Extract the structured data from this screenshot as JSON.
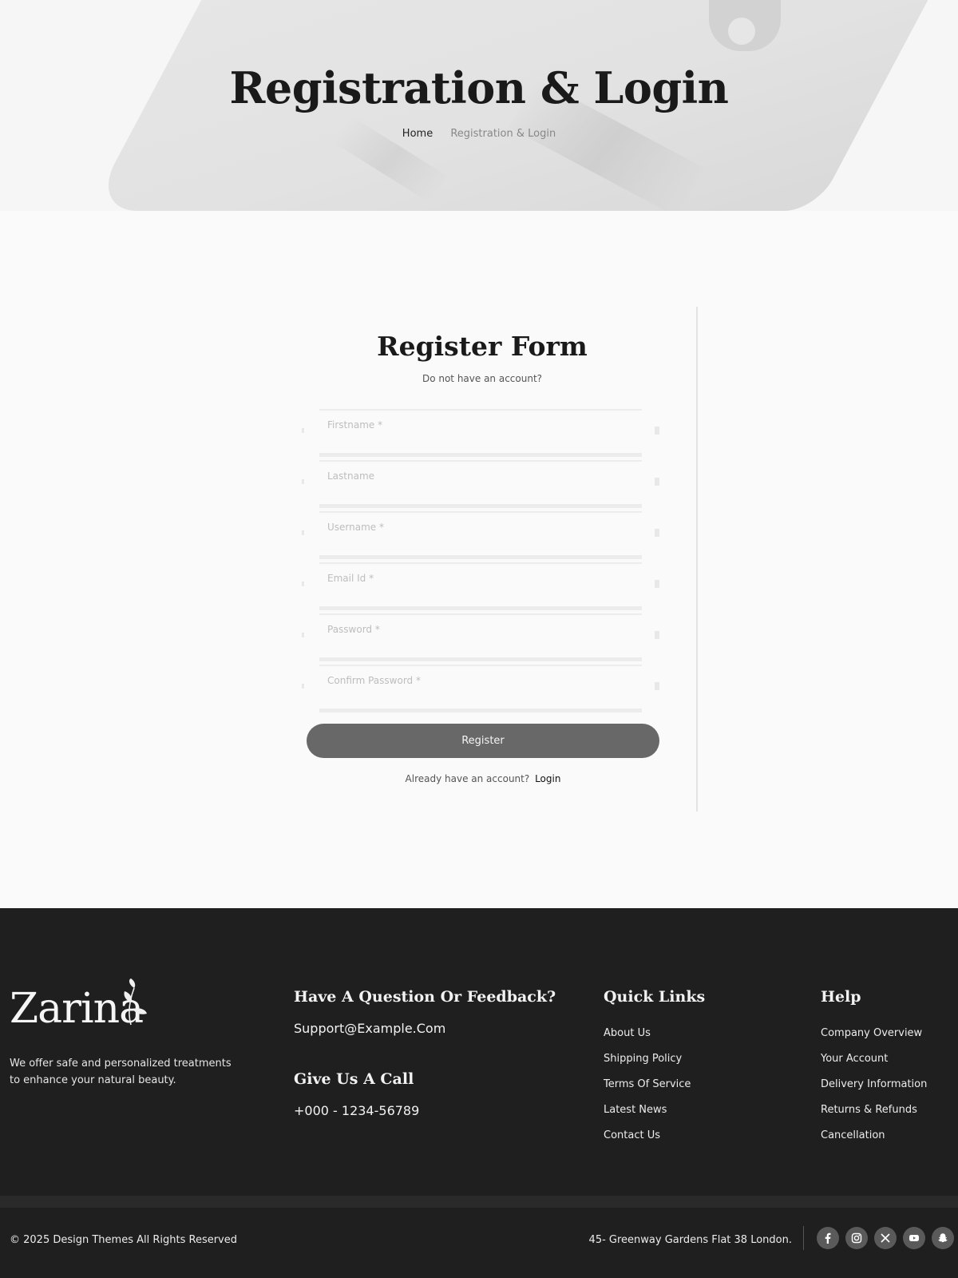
{
  "hero": {
    "title": "Registration & Login",
    "breadcrumb": {
      "home": "Home",
      "current": "Registration & Login"
    }
  },
  "form": {
    "title": "Register Form",
    "subtitle": "Do not have an account?",
    "fields": [
      {
        "placeholder": "Firstname *"
      },
      {
        "placeholder": "Lastname"
      },
      {
        "placeholder": "Username *"
      },
      {
        "placeholder": "Email Id *"
      },
      {
        "placeholder": "Password *"
      },
      {
        "placeholder": "Confirm Password *"
      }
    ],
    "register_label": "Register",
    "login_prompt": "Already have an account?",
    "login_link": "Login"
  },
  "footer": {
    "logo": "Zarina",
    "description": "We offer safe and personalized treatments to enhance your natural beauty.",
    "question_title": "Have A Question Or Feedback?",
    "email": "Support@Example.Com",
    "call_title": "Give Us A Call",
    "phone": "+000 - 1234-56789",
    "quick_links": {
      "title": "Quick Links",
      "items": [
        "About Us",
        "Shipping Policy",
        "Terms Of Service",
        "Latest News",
        "Contact Us"
      ]
    },
    "help": {
      "title": "Help",
      "items": [
        "Company Overview",
        "Your Account",
        "Delivery Information",
        "Returns & Refunds",
        "Cancellation"
      ]
    },
    "copyright": "© 2025 Design Themes All Rights Reserved",
    "address": "45- Greenway Gardens Flat 38 London.",
    "socials": [
      "facebook-icon",
      "instagram-icon",
      "x-icon",
      "youtube-icon",
      "snapchat-icon"
    ]
  }
}
